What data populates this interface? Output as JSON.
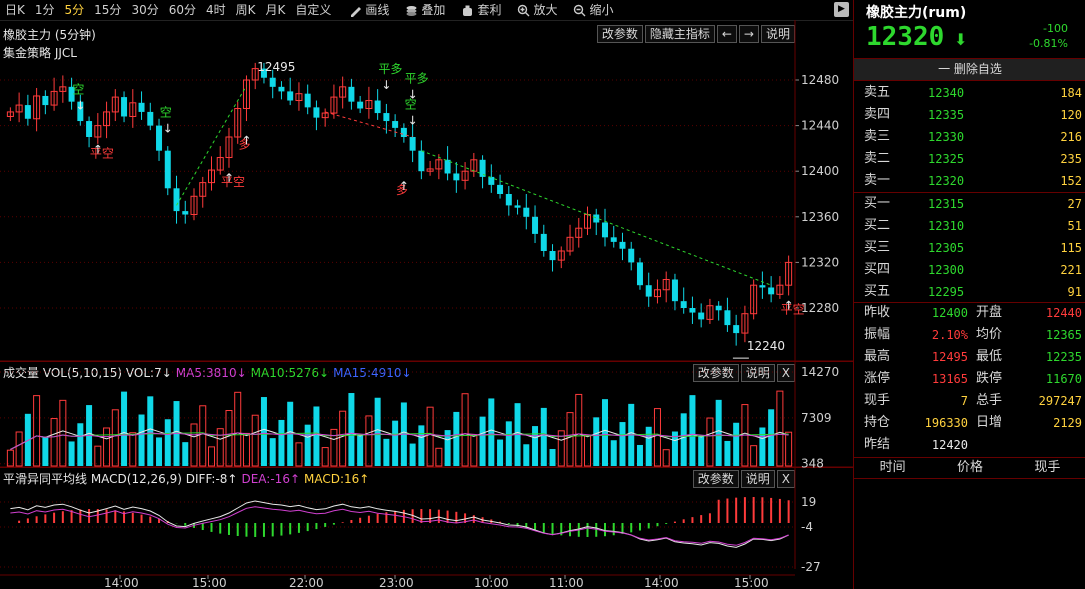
{
  "toolbar": {
    "periods": [
      "日K",
      "1分",
      "5分",
      "15分",
      "30分",
      "60分",
      "4时",
      "周K",
      "月K",
      "自定义"
    ],
    "active_period": "5分",
    "tools": [
      {
        "icon": "pencil-icon",
        "label": "画线"
      },
      {
        "icon": "stack-icon",
        "label": "叠加"
      },
      {
        "icon": "bag-icon",
        "label": "套利"
      },
      {
        "icon": "zoom-in-icon",
        "label": "放大"
      },
      {
        "icon": "zoom-out-icon",
        "label": "缩小"
      }
    ],
    "collapse_glyph": "▶"
  },
  "main_panel": {
    "title": "橡胶主力 (5分钟)",
    "strategy": "集金策略 JJCL",
    "buttons": [
      "改参数",
      "隐藏主指标",
      "←",
      "→",
      "说明"
    ],
    "y_ticks": [
      "12480",
      "12440",
      "12400",
      "12360",
      "12320",
      "12280"
    ],
    "high_label": "12495",
    "low_label": "12240"
  },
  "volume_panel": {
    "title": "成交量 VOL(5,10,15) VOL:7↓",
    "ma5": "MA5:3810↓",
    "ma10": "MA10:5276↓",
    "ma15": "MA15:4910↓",
    "buttons": [
      "改参数",
      "说明",
      "X"
    ],
    "y_ticks": [
      "14270",
      "7309",
      "348"
    ]
  },
  "macd_panel": {
    "title": "平滑异同平均线 MACD(12,26,9) DIFF:-8↑",
    "dea": "DEA:-16↑",
    "macd": "MACD:16↑",
    "buttons": [
      "改参数",
      "说明",
      "X"
    ],
    "y_ticks": [
      "19",
      "-4",
      "-27"
    ]
  },
  "x_axis": [
    "14:00",
    "15:00",
    "22:00",
    "23:00",
    "10:00",
    "11:00",
    "14:00",
    "15:00"
  ],
  "signals": [
    {
      "text": "空",
      "color": "#2ed82e"
    },
    {
      "text": "平空",
      "color": "#ff3b3b"
    },
    {
      "text": "空",
      "color": "#2ed82e"
    },
    {
      "text": "平空",
      "color": "#ff3b3b"
    },
    {
      "text": "多",
      "color": "#ff3b3b"
    },
    {
      "text": "平多",
      "color": "#2ed82e"
    },
    {
      "text": "平多",
      "color": "#2ed82e"
    },
    {
      "text": "空",
      "color": "#2ed82e"
    },
    {
      "text": "多",
      "color": "#ff3b3b"
    },
    {
      "text": "平空",
      "color": "#ff3b3b"
    }
  ],
  "quote": {
    "title": "橡胶主力(rum)",
    "price": "12320",
    "arrow": "⬇",
    "change": "-100",
    "change_pct": "-0.81%",
    "remove_label": "一 删除自选"
  },
  "orderbook": {
    "asks": [
      {
        "label": "卖五",
        "price": "12340",
        "vol": "184"
      },
      {
        "label": "卖四",
        "price": "12335",
        "vol": "120"
      },
      {
        "label": "卖三",
        "price": "12330",
        "vol": "216"
      },
      {
        "label": "卖二",
        "price": "12325",
        "vol": "235"
      },
      {
        "label": "卖一",
        "price": "12320",
        "vol": "152"
      }
    ],
    "bids": [
      {
        "label": "买一",
        "price": "12315",
        "vol": "27"
      },
      {
        "label": "买二",
        "price": "12310",
        "vol": "51"
      },
      {
        "label": "买三",
        "price": "12305",
        "vol": "115"
      },
      {
        "label": "买四",
        "price": "12300",
        "vol": "221"
      },
      {
        "label": "买五",
        "price": "12295",
        "vol": "91"
      }
    ]
  },
  "stats": [
    {
      "l1": "昨收",
      "v1": "12400",
      "c1": "green",
      "l2": "开盘",
      "v2": "12440",
      "c2": "red"
    },
    {
      "l1": "振幅",
      "v1": "2.10%",
      "c1": "red",
      "l2": "均价",
      "v2": "12365",
      "c2": "green"
    },
    {
      "l1": "最高",
      "v1": "12495",
      "c1": "red",
      "l2": "最低",
      "v2": "12235",
      "c2": "green"
    },
    {
      "l1": "涨停",
      "v1": "13165",
      "c1": "red",
      "l2": "跌停",
      "v2": "11670",
      "c2": "green"
    },
    {
      "l1": "现手",
      "v1": "7",
      "c1": "yellow",
      "l2": "总手",
      "v2": "297247",
      "c2": "yellow"
    },
    {
      "l1": "持仓",
      "v1": "196330",
      "c1": "yellow",
      "l2": "日增",
      "v2": "2129",
      "c2": "yellow"
    },
    {
      "l1": "昨结",
      "v1": "12420",
      "c1": "white",
      "l2": "",
      "v2": "",
      "c2": "white"
    }
  ],
  "ticks_header": [
    "时间",
    "价格",
    "现手"
  ],
  "colors": {
    "up": "#ff3b3b",
    "down": "#10d8e8",
    "ma5": "#e8e8e8",
    "ma10": "#2ed82e",
    "ma15": "#d040d0",
    "trend": "#2ed82e",
    "gridline": "#5a0000"
  },
  "chart_data": {
    "type": "candlestick",
    "price_range": [
      12235,
      12495
    ],
    "closes": [
      12452,
      12458,
      12446,
      12466,
      12458,
      12470,
      12474,
      12461,
      12444,
      12430,
      12440,
      12452,
      12465,
      12448,
      12460,
      12452,
      12440,
      12418,
      12385,
      12365,
      12362,
      12378,
      12390,
      12401,
      12412,
      12430,
      12455,
      12480,
      12490,
      12482,
      12474,
      12470,
      12462,
      12468,
      12456,
      12447,
      12451,
      12465,
      12474,
      12461,
      12455,
      12462,
      12451,
      12444,
      12438,
      12430,
      12418,
      12400,
      12402,
      12410,
      12398,
      12392,
      12400,
      12410,
      12395,
      12388,
      12380,
      12370,
      12368,
      12360,
      12345,
      12330,
      12322,
      12330,
      12342,
      12350,
      12362,
      12355,
      12342,
      12338,
      12332,
      12320,
      12300,
      12290,
      12296,
      12305,
      12286,
      12280,
      12276,
      12270,
      12282,
      12278,
      12265,
      12258,
      12275,
      12300,
      12298,
      12292,
      12300,
      12320
    ]
  }
}
